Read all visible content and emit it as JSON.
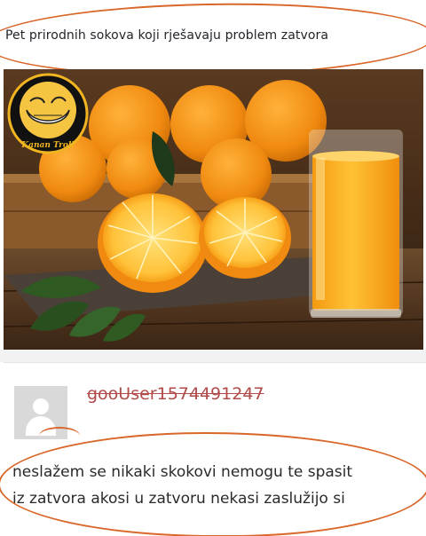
{
  "post": {
    "headline": "Pet prirodnih sokova koji rješavaju problem zatvora"
  },
  "photo": {
    "watermark_text": "Kanan Troll"
  },
  "comment": {
    "username": "gooUser1574491247",
    "text_line1": "neslažem se nikaki skokovi nemogu te spasit",
    "text_line2": "iz zatvora akosi u zatvoru nekasi zaslužijo si"
  },
  "colors": {
    "annotation_circle": "#d9672a",
    "username": "#b04b49",
    "orange_juice": "#f7a51c",
    "orange_fruit": "#f28c12"
  }
}
